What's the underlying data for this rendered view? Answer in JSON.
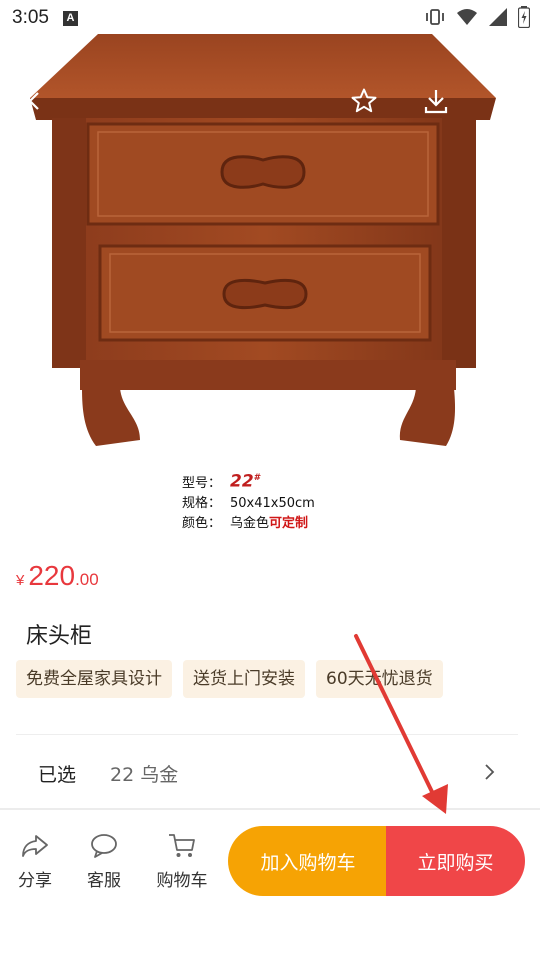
{
  "status_bar": {
    "time": "3:05",
    "notification_letter": "A"
  },
  "product_image": {
    "spec_model_key": "型号：",
    "spec_model_value": "22",
    "spec_model_mark": "#",
    "spec_size_key": "规格：",
    "spec_size_value": "50x41x50cm",
    "spec_color_key": "颜色：",
    "spec_color_value": "乌金色",
    "spec_color_custom": "可定制"
  },
  "price": {
    "symbol": "¥",
    "integer": "220",
    "decimal": ".00",
    "color": "#e8383d"
  },
  "product": {
    "title": "床头柜",
    "tags": [
      "免费全屋家具设计",
      "送货上门安装",
      "60天无忧退货"
    ]
  },
  "selection": {
    "label": "已选",
    "value": "22 乌金"
  },
  "bottom_bar": {
    "share_label": "分享",
    "service_label": "客服",
    "cart_label": "购物车",
    "add_to_cart_label": "加入购物车",
    "buy_now_label": "立即购买",
    "add_to_cart_color": "#f6a304",
    "buy_now_color": "#f04648"
  },
  "icons": [
    "back-icon",
    "star-icon",
    "download-icon",
    "share-icon",
    "chat-icon",
    "cart-icon",
    "chevron-right-icon"
  ]
}
